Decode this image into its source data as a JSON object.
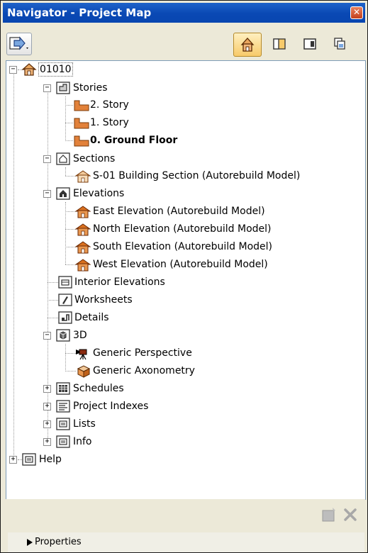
{
  "window": {
    "title": "Navigator - Project Map",
    "close_glyph": "✕"
  },
  "toolbar": {
    "left_button_icon": "navigate-arrow-icon",
    "view_buttons": [
      "project-map-icon",
      "view-map-icon",
      "layout-book-icon",
      "publisher-sets-icon"
    ]
  },
  "tree": {
    "root": "01010",
    "stories": {
      "label": "Stories",
      "items": [
        "2. Story",
        "1. Story",
        "0. Ground Floor"
      ]
    },
    "sections": {
      "label": "Sections",
      "items": [
        "S-01 Building Section (Autorebuild Model)"
      ]
    },
    "elevations": {
      "label": "Elevations",
      "items": [
        "East Elevation (Autorebuild Model)",
        "North Elevation (Autorebuild Model)",
        "South Elevation (Autorebuild Model)",
        "West Elevation (Autorebuild Model)"
      ]
    },
    "interior_elevations": "Interior Elevations",
    "worksheets": "Worksheets",
    "details": "Details",
    "three_d": {
      "label": "3D",
      "items": [
        "Generic Perspective",
        "Generic Axonometry"
      ]
    },
    "schedules": "Schedules",
    "project_indexes": "Project Indexes",
    "lists": "Lists",
    "info": "Info",
    "help": "Help"
  },
  "properties": {
    "label": "Properties"
  },
  "colors": {
    "titlebar": "#0a48b4",
    "story_icon": "#e2813a",
    "selected_toolbar": "#f7ca6a"
  }
}
